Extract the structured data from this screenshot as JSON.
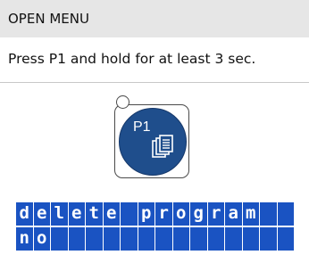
{
  "header": {
    "title": "OPEN MENU"
  },
  "instruction": {
    "text": "Press P1 and hold for at least 3 sec."
  },
  "key": {
    "label": "P1",
    "icon": "copy-icon",
    "button_color": "#1f4e8c"
  },
  "lcd": {
    "line1": "delete program",
    "line2": "no",
    "columns": 16,
    "background": "#1a53c2",
    "text_color": "#ffffff"
  }
}
